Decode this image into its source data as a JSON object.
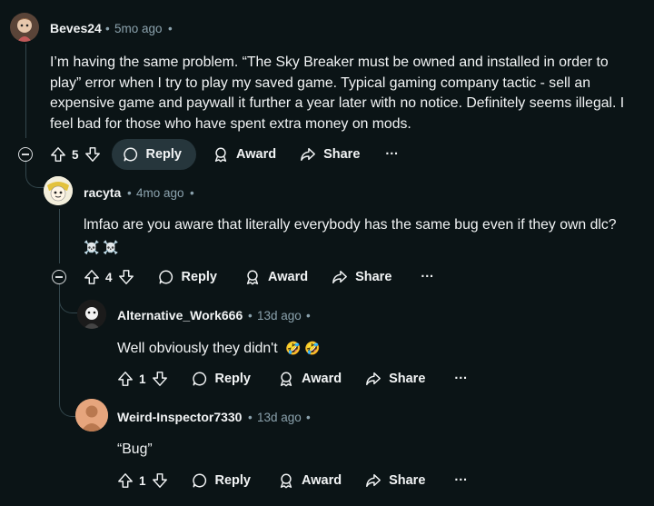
{
  "comments": [
    {
      "username": "Beves24",
      "time": "5mo ago",
      "body": "I’m having the same problem. “The Sky Breaker must be owned and installed in order to play” error when I try to play my saved game. Typical gaming company tactic - sell an expensive game and paywall it further a year later with no notice. Definitely seems illegal. I feel bad for those who have spent extra money on mods.",
      "votes": "5",
      "avatar_color": "#c9a98a"
    },
    {
      "username": "racyta",
      "time": "4mo ago",
      "body": "lmfao are you aware that literally everybody has the same bug even if they own dlc?",
      "emoji": "☠️ ☠️",
      "votes": "4",
      "avatar_color": "#e8e1c8"
    },
    {
      "username": "Alternative_Work666",
      "time": "13d ago",
      "body": "Well obviously they didn't",
      "emoji": "🤣 🤣",
      "votes": "1",
      "avatar_color": "#2a2a2a"
    },
    {
      "username": "Weird-Inspector7330",
      "time": "13d ago",
      "body": "“Bug”",
      "votes": "1",
      "avatar_color": "#e0a37a"
    }
  ],
  "labels": {
    "reply": "Reply",
    "award": "Award",
    "share": "Share",
    "more": "···",
    "sep": "•"
  },
  "colors": {
    "background": "#0b1416",
    "text": "#f2f4f5",
    "meta": "#8ba2ad",
    "thread_line": "#33464c",
    "reply_pill": "#26363c"
  }
}
